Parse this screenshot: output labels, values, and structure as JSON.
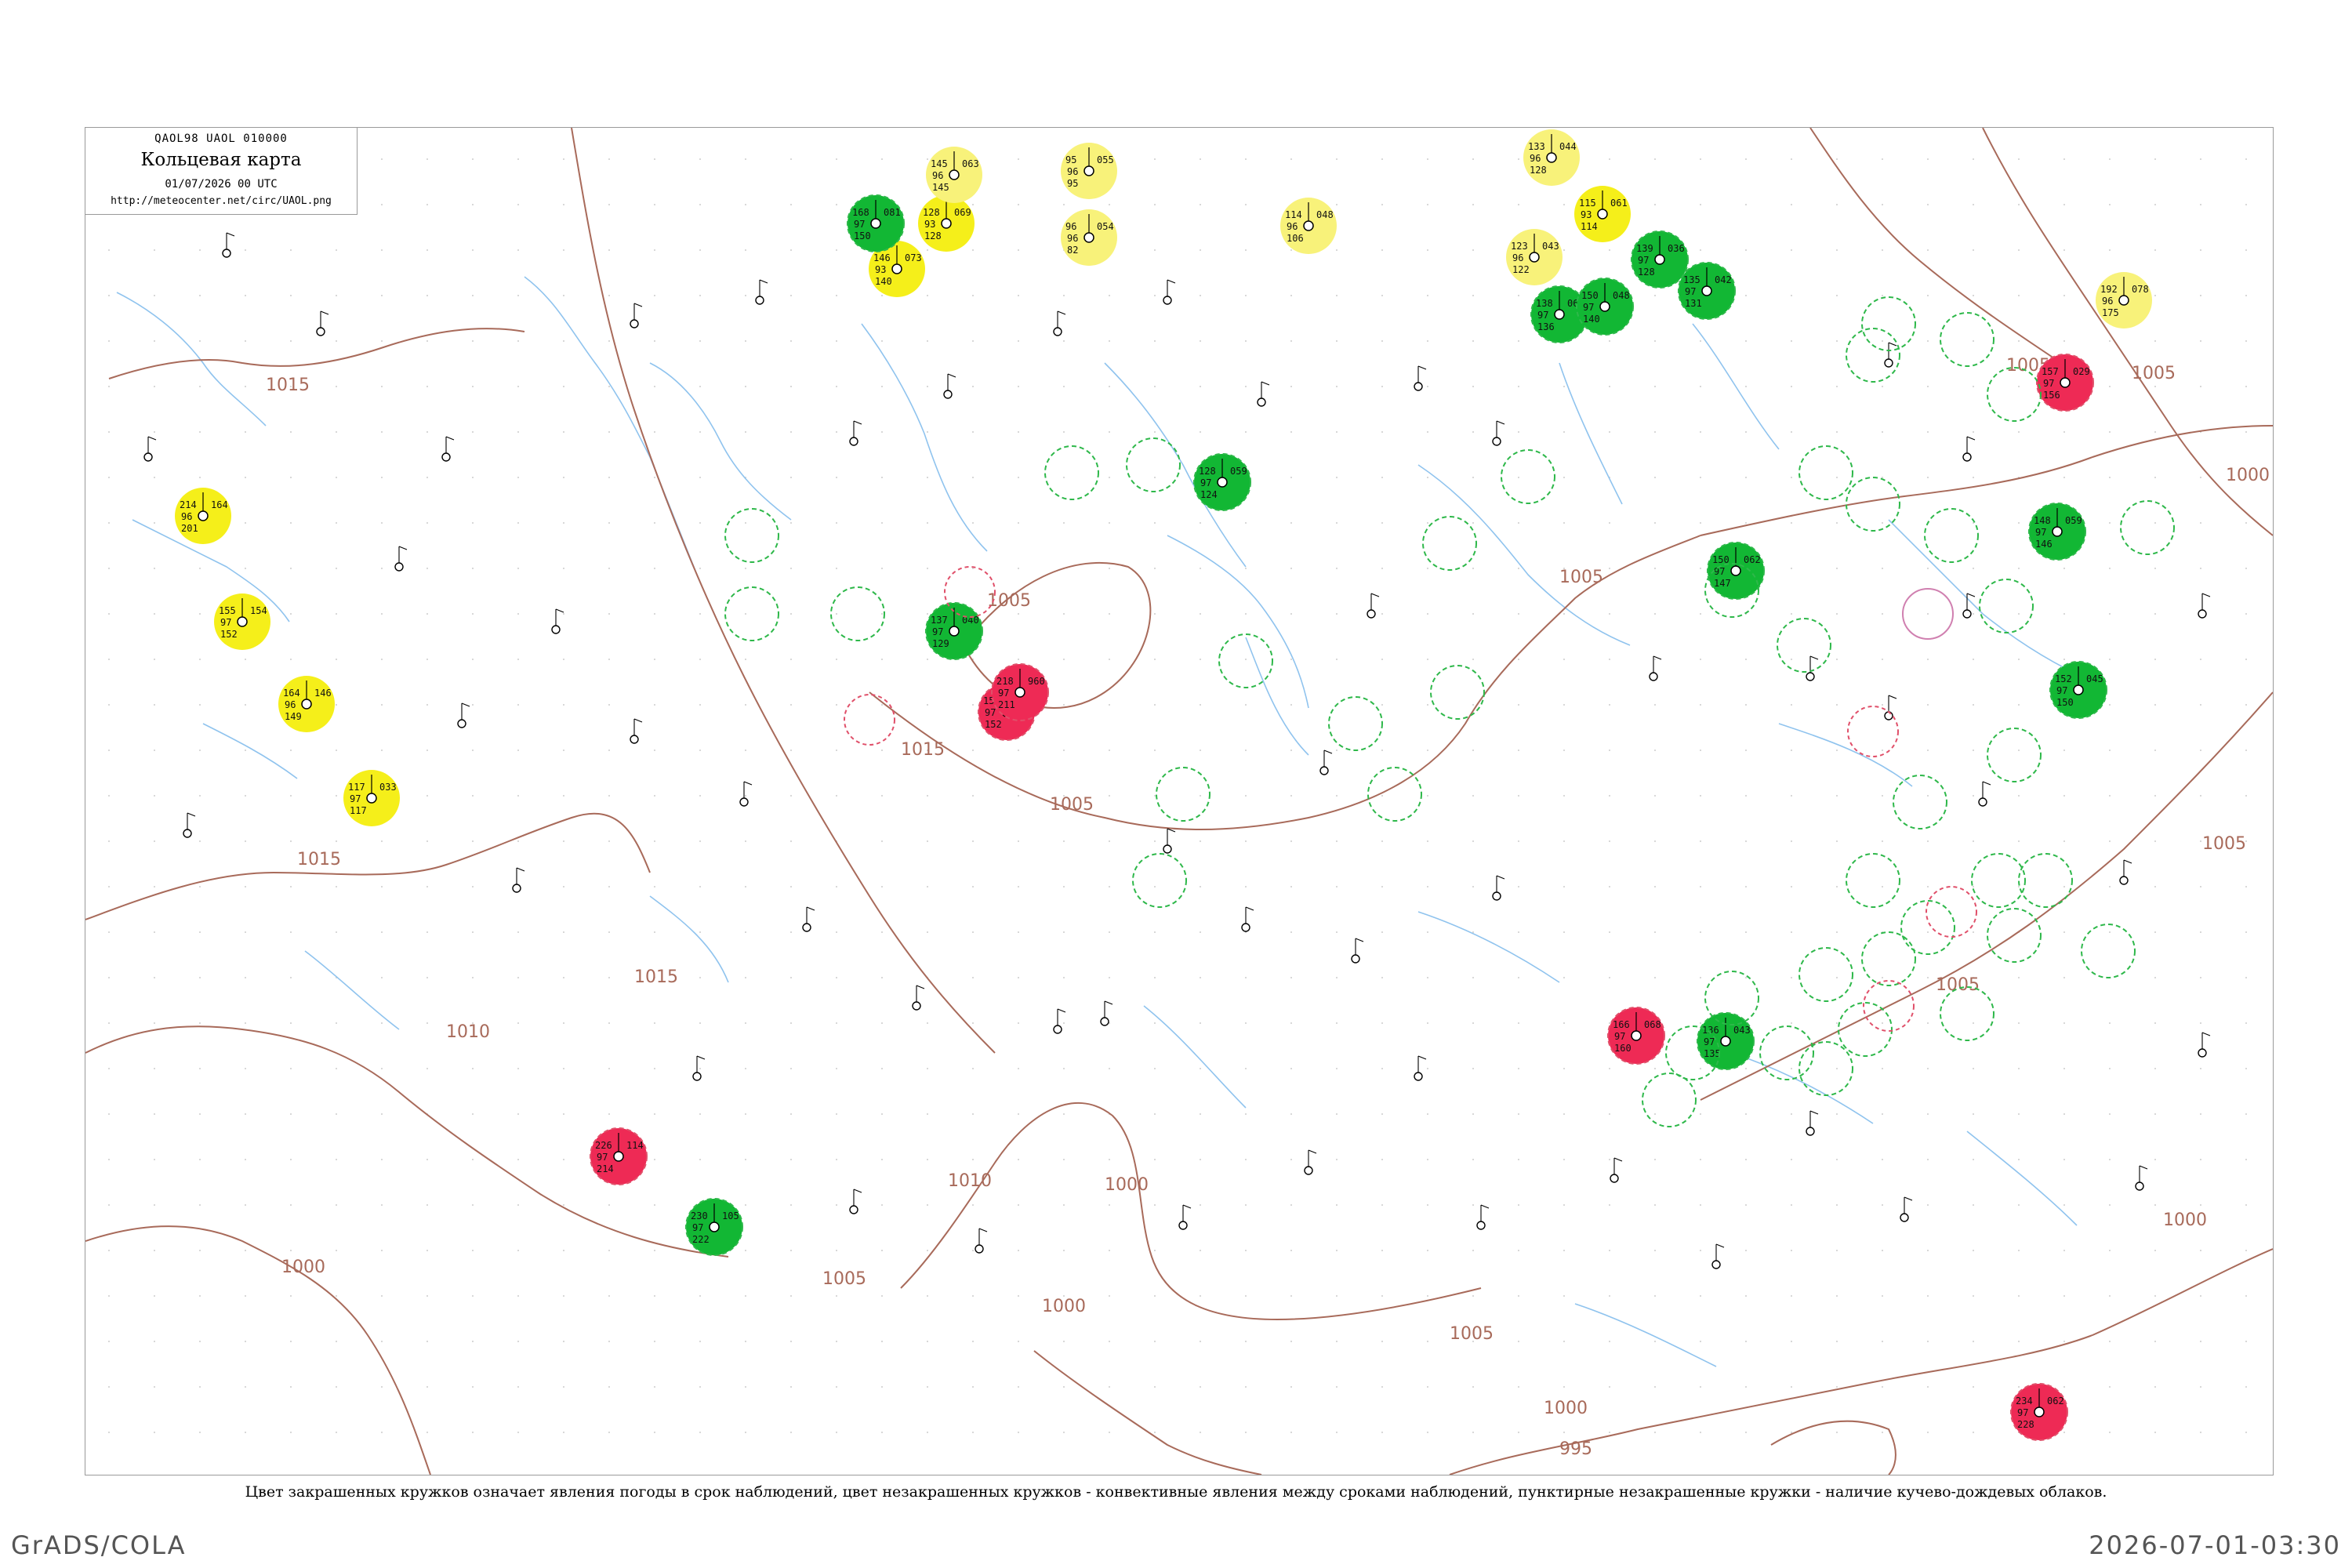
{
  "header": {
    "codes": "QAOL98  UAOL  010000",
    "title": "Кольцевая карта",
    "date": "01/07/2026 00 UTC",
    "url": "http://meteocenter.net/circ/UAOL.png"
  },
  "caption": "Цвет закрашенных кружков означает явления погоды в срок наблюдений, цвет незакрашенных кружков - конвективные явления между сроками наблюдений, пунктирные незакрашенные кружки - наличие кучево-дождевых облаков.",
  "footer": {
    "left": "GrADS/COLA",
    "right": "2026-07-01-03:30"
  },
  "colors": {
    "isobar": "#a86a5a",
    "river": "#8fc3ee",
    "fill_green": "#12b734",
    "fill_red": "#ee2a55",
    "fill_yellow": "#f5ef1a",
    "fill_yellow_light": "#f8f27a",
    "ring_green": "#2eb84a",
    "ring_red": "#e0506a",
    "ring_pink": "#d080b0"
  },
  "isobar_labels": [
    "1015",
    "1015",
    "1015",
    "1015",
    "1015",
    "1010",
    "1010",
    "1010",
    "1005",
    "1005",
    "1005",
    "1005",
    "1005",
    "1005",
    "1005",
    "1005",
    "1005",
    "1000",
    "1000",
    "1000",
    "1000",
    "1000",
    "1000",
    "995"
  ],
  "stations": [
    {
      "t": "214",
      "p": "164",
      "d": "96",
      "n": "201",
      "fill": "yellow"
    },
    {
      "t": "155",
      "p": "154",
      "d": "97",
      "n": "152",
      "fill": "yellow"
    },
    {
      "t": "164",
      "p": "146",
      "d": "96",
      "n": "149",
      "fill": "yellow"
    },
    {
      "t": "117",
      "p": "033",
      "d": "97",
      "n": "117",
      "fill": "yellow"
    },
    {
      "t": "146",
      "p": "073",
      "d": "93",
      "n": "140",
      "fill": "yellow"
    },
    {
      "t": "128",
      "p": "069",
      "d": "93",
      "n": "128",
      "fill": "yellow"
    },
    {
      "t": "145",
      "p": "063",
      "d": "96",
      "n": "145",
      "fill": "yellow_light"
    },
    {
      "t": "95",
      "p": "055",
      "d": "96",
      "n": "95",
      "fill": "yellow_light"
    },
    {
      "t": "96",
      "p": "054",
      "d": "96",
      "n": "82",
      "fill": "yellow_light"
    },
    {
      "t": "114",
      "p": "048",
      "d": "96",
      "n": "106",
      "fill": "yellow_light"
    },
    {
      "t": "133",
      "p": "044",
      "d": "96",
      "n": "128",
      "fill": "yellow_light"
    },
    {
      "t": "115",
      "p": "061",
      "d": "93",
      "n": "114",
      "fill": "yellow"
    },
    {
      "t": "123",
      "p": "043",
      "d": "96",
      "n": "122",
      "fill": "yellow_light"
    },
    {
      "t": "192",
      "p": "078",
      "d": "96",
      "n": "175",
      "fill": "yellow_light"
    },
    {
      "t": "168",
      "p": "081",
      "d": "97",
      "n": "150",
      "fill": "green"
    },
    {
      "t": "138",
      "p": "062",
      "d": "97",
      "n": "136",
      "fill": "green"
    },
    {
      "t": "150",
      "p": "048",
      "d": "97",
      "n": "140",
      "fill": "green"
    },
    {
      "t": "139",
      "p": "036",
      "d": "97",
      "n": "128",
      "fill": "green"
    },
    {
      "t": "135",
      "p": "042",
      "d": "97",
      "n": "131",
      "fill": "green"
    },
    {
      "t": "137",
      "p": "040",
      "d": "97",
      "n": "129",
      "fill": "green"
    },
    {
      "t": "128",
      "p": "059",
      "d": "97",
      "n": "124",
      "fill": "green"
    },
    {
      "t": "148",
      "p": "059",
      "d": "97",
      "n": "146",
      "fill": "green"
    },
    {
      "t": "152",
      "p": "045",
      "d": "97",
      "n": "150",
      "fill": "green"
    },
    {
      "t": "150",
      "p": "062",
      "d": "97",
      "n": "147",
      "fill": "green"
    },
    {
      "t": "136",
      "p": "043",
      "d": "97",
      "n": "135",
      "fill": "green"
    },
    {
      "t": "230",
      "p": "105",
      "d": "97",
      "n": "222",
      "fill": "green"
    },
    {
      "t": "154",
      "p": "003",
      "d": "97",
      "n": "152",
      "fill": "red"
    },
    {
      "t": "157",
      "p": "029",
      "d": "97",
      "n": "156",
      "fill": "red"
    },
    {
      "t": "166",
      "p": "068",
      "d": "97",
      "n": "160",
      "fill": "red"
    },
    {
      "t": "226",
      "p": "114",
      "d": "97",
      "n": "214",
      "fill": "red"
    },
    {
      "t": "234",
      "p": "062",
      "d": "97",
      "n": "228",
      "fill": "red"
    },
    {
      "t": "218",
      "p": "960",
      "d": "97",
      "n": "211",
      "fill": "red"
    }
  ]
}
